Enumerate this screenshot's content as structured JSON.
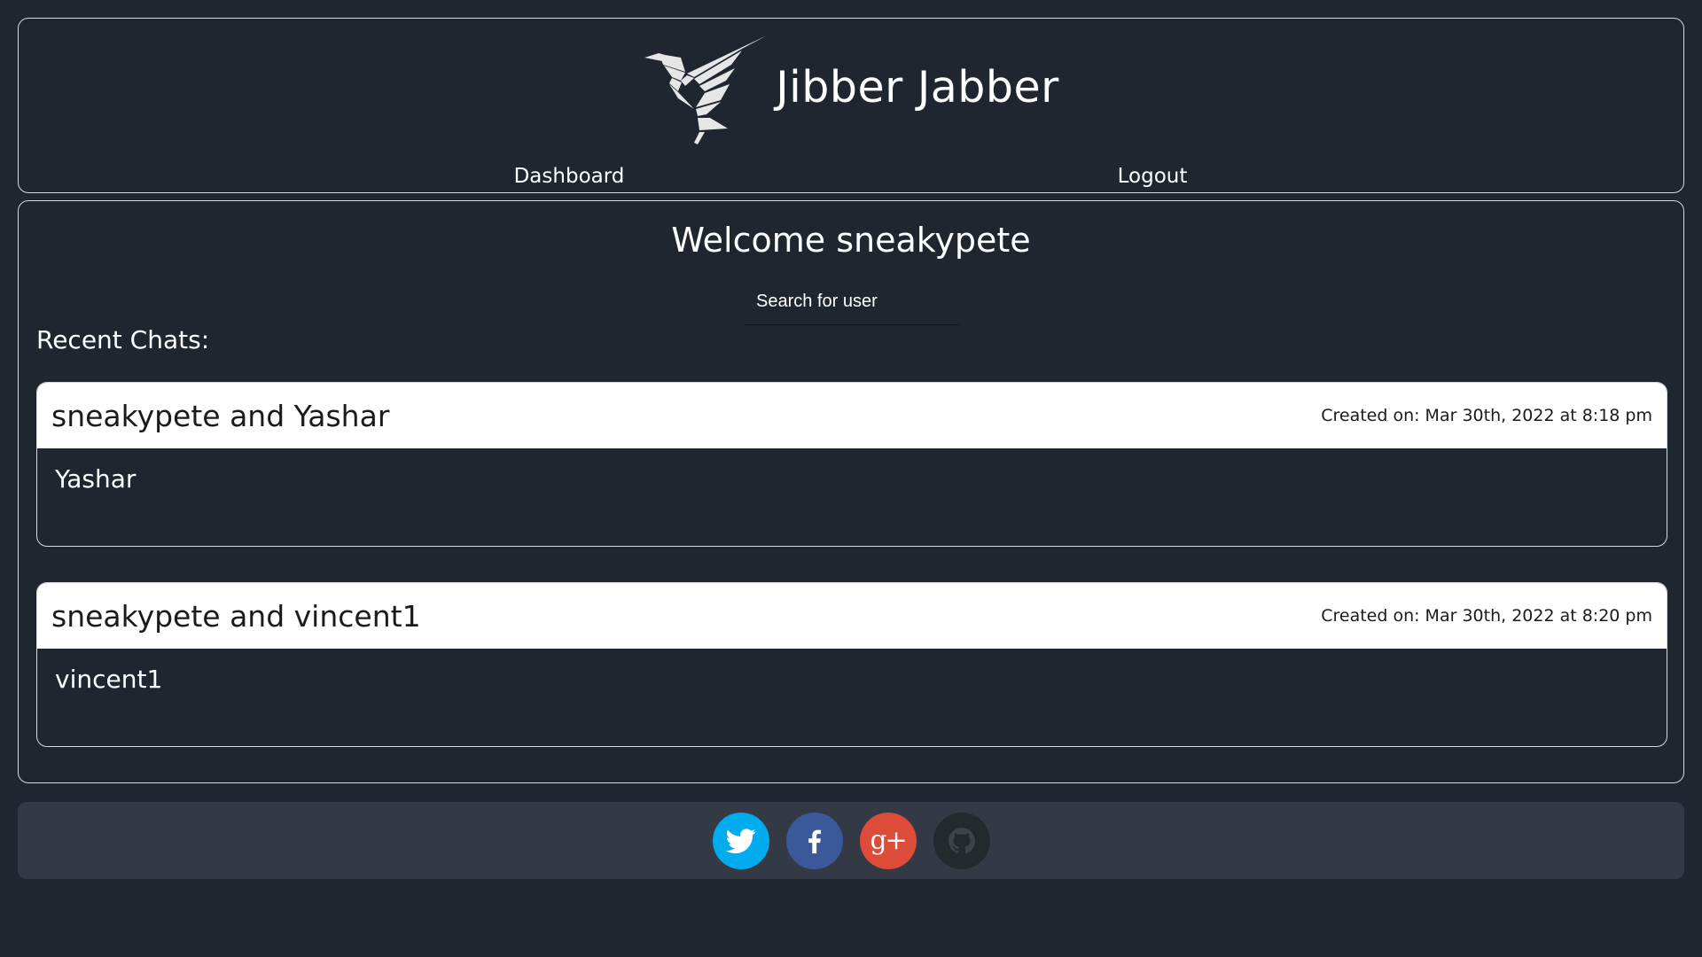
{
  "header": {
    "brand_title": "Jibber Jabber",
    "nav": {
      "dashboard": "Dashboard",
      "logout": "Logout"
    }
  },
  "main": {
    "welcome": "Welcome sneakypete",
    "search_placeholder": "Search for user",
    "recent_label": "Recent Chats:",
    "chats": [
      {
        "title": "sneakypete and Yashar",
        "created": "Created on: Mar 30th, 2022 at 8:18 pm",
        "member": "Yashar"
      },
      {
        "title": "sneakypete and vincent1",
        "created": "Created on: Mar 30th, 2022 at 8:20 pm",
        "member": "vincent1"
      }
    ]
  },
  "footer": {
    "social": [
      {
        "icon": "twitter-icon",
        "color": "#00aced"
      },
      {
        "icon": "facebook-icon",
        "color": "#3b5998"
      },
      {
        "icon": "google-plus-icon",
        "color": "#dd4b39",
        "glyph": "g+"
      },
      {
        "icon": "github-icon",
        "color": "#24292e"
      }
    ]
  },
  "colors": {
    "background": "#1f2630",
    "footer_background": "#343a45",
    "border": "#d7d9dc",
    "card_header": "#ffffff"
  }
}
